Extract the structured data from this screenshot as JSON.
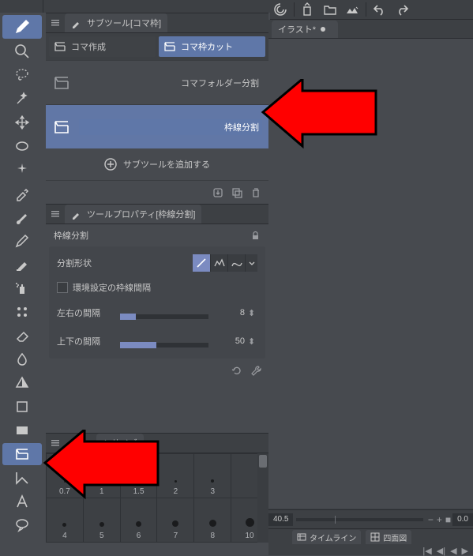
{
  "subtool_panel": {
    "title": "サブツール[コマ枠]",
    "tabs": [
      {
        "label": "コマ作成",
        "active": false
      },
      {
        "label": "コマ枠カット",
        "active": true
      }
    ],
    "items": [
      {
        "label": "コマフォルダー分割",
        "selected": false
      },
      {
        "label": "枠線分割",
        "selected": true
      }
    ],
    "add_label": "サブツールを追加する"
  },
  "tool_property": {
    "title": "ツールプロパティ[枠線分割]",
    "subtitle": "枠線分割",
    "shape_label": "分割形状",
    "checkbox_label": "環境設定の枠線間隔",
    "spacing_h_label": "左右の間隔",
    "spacing_h_value": "8",
    "spacing_v_label": "上下の間隔",
    "spacing_v_value": "50"
  },
  "brush_size": {
    "title": "シサイズ",
    "row1": [
      "0.7",
      "1",
      "1.5",
      "2",
      "3"
    ],
    "row2": [
      "4",
      "5",
      "6",
      "7",
      "8",
      "10"
    ]
  },
  "canvas": {
    "tab_label": "イラスト*"
  },
  "zoom": {
    "left_value": "40.5",
    "right_value": "0.0"
  },
  "timeline": {
    "tab1": "タイムライン",
    "tab2": "四面図"
  }
}
